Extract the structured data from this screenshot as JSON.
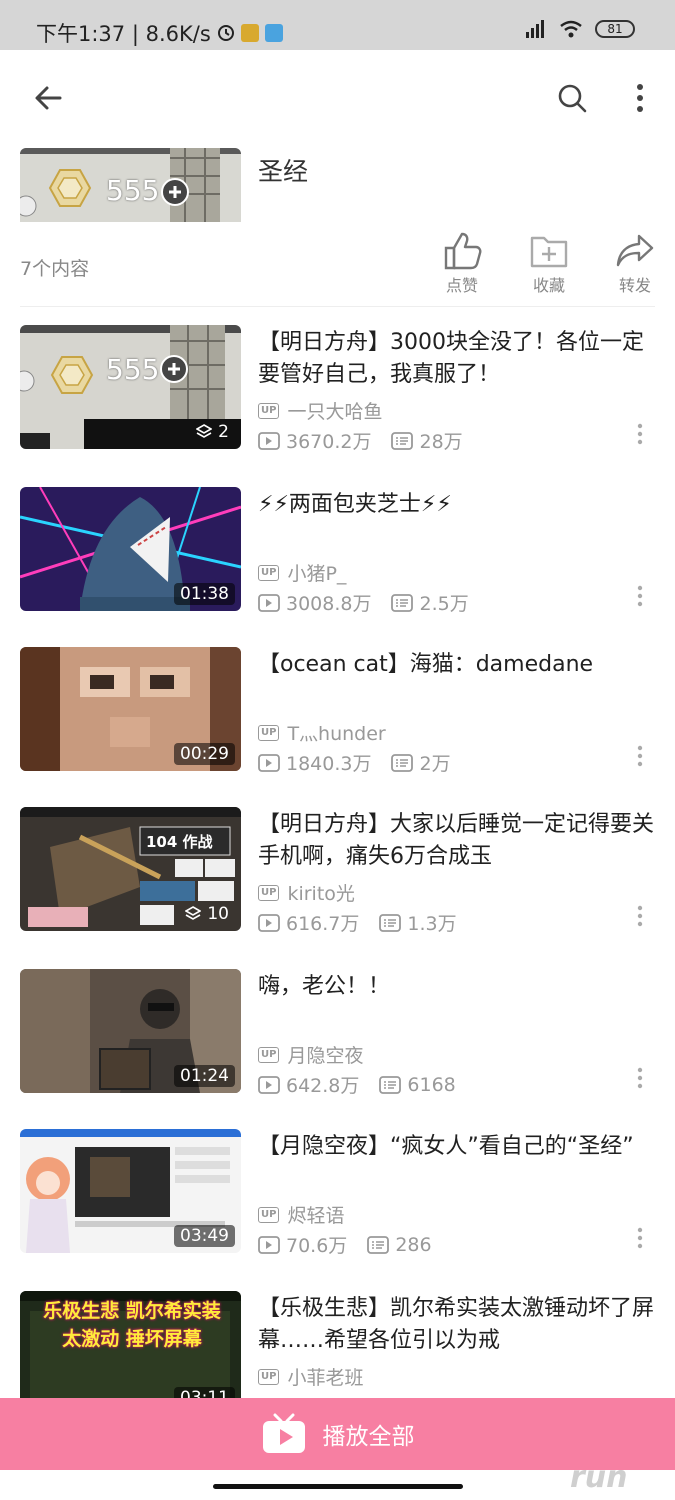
{
  "status_bar": {
    "time_speed": "下午1:37 | 8.6K/s",
    "battery": "81"
  },
  "playlist": {
    "title": "圣经",
    "count_text": "7个内容",
    "cover_points": "555",
    "actions": [
      {
        "label": "点赞",
        "icon": "thumb-up-icon"
      },
      {
        "label": "收藏",
        "icon": "folder-add-icon"
      },
      {
        "label": "转发",
        "icon": "share-icon"
      }
    ]
  },
  "videos": [
    {
      "title": "【明日方舟】3000块全没了！各位一定要管好自己，我真服了！",
      "up": "一只大哈鱼",
      "views": "3670.2万",
      "danmaku": "28万",
      "badge": "2",
      "badge_type": "multi",
      "thumb_text": "555"
    },
    {
      "title": "⚡⚡两面包夹芝士⚡⚡",
      "up": "小猪P_",
      "views": "3008.8万",
      "danmaku": "2.5万",
      "badge": "01:38",
      "badge_type": "duration"
    },
    {
      "title": "【ocean cat】海猫：damedane",
      "up": "T灬hunder",
      "views": "1840.3万",
      "danmaku": "2万",
      "badge": "00:29",
      "badge_type": "duration"
    },
    {
      "title": "【明日方舟】大家以后睡觉一定记得要关手机啊，痛失6万合成玉",
      "up": "kirito光",
      "views": "616.7万",
      "danmaku": "1.3万",
      "badge": "10",
      "badge_type": "multi",
      "thumb_text": "104 作战"
    },
    {
      "title": "嗨，老公！！",
      "up": "月隐空夜",
      "views": "642.8万",
      "danmaku": "6168",
      "badge": "01:24",
      "badge_type": "duration"
    },
    {
      "title": "【月隐空夜】“疯女人”看自己的“圣经”",
      "up": "烬轻语",
      "views": "70.6万",
      "danmaku": "286",
      "badge": "03:49",
      "badge_type": "duration"
    },
    {
      "title": "【乐极生悲】凯尔希实装太激锤动坏了屏幕……希望各位引以为戒",
      "up": "小菲老班",
      "views": "",
      "danmaku": "",
      "badge": "03:11",
      "badge_type": "duration",
      "thumb_text": "乐极生悲 凯尔希实装太激动 捶坏屏幕"
    }
  ],
  "play_all_label": "播放全部",
  "up_tag": "UP",
  "colors": {
    "accent": "#f77fa2",
    "meta": "#999999",
    "status_bar": "#d6d6d6"
  }
}
